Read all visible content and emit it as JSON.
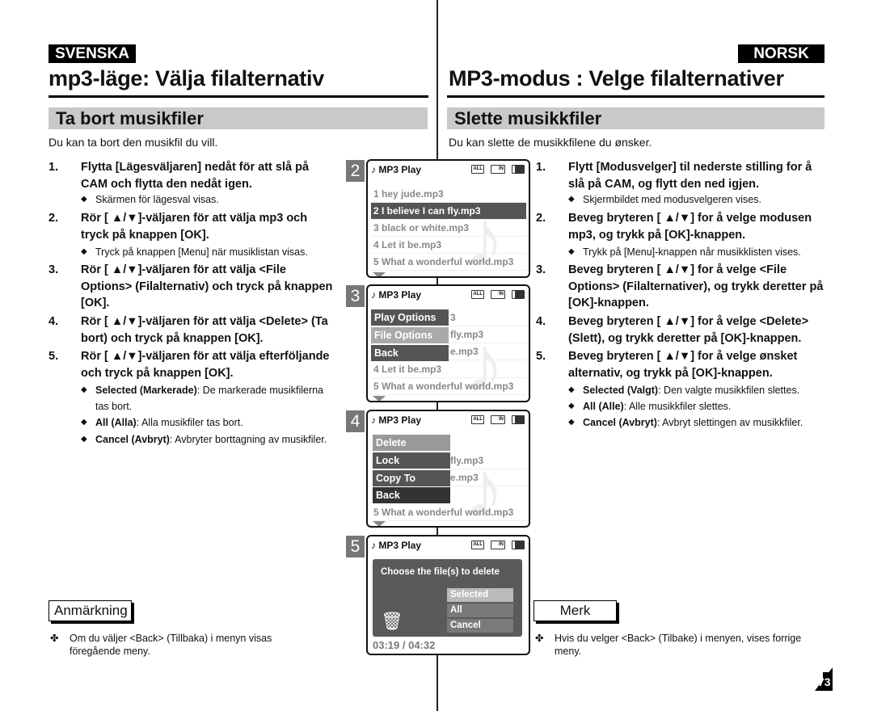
{
  "sv": {
    "lang": "SVENSKA",
    "title": "mp3-läge: Välja filalternativ",
    "section": "Ta bort musikfiler",
    "intro": "Du kan ta bort den musikfil du vill.",
    "steps": [
      {
        "n": "1.",
        "text": "Flytta [Lägesväljaren] nedåt för att slå på CAM och flytta den nedåt igen."
      },
      {
        "n": "2.",
        "text": "Rör [ ▲/▼]-väljaren för att välja mp3 och tryck på knappen [OK]."
      },
      {
        "n": "3.",
        "text": "Rör [ ▲/▼]-väljaren för att välja <File Options> (Filalternativ) och tryck på knappen [OK]."
      },
      {
        "n": "4.",
        "text": "Rör [ ▲/▼]-väljaren för att välja <Delete> (Ta bort) och tryck på knappen [OK]."
      },
      {
        "n": "5.",
        "text": "Rör [ ▲/▼]-väljaren för att välja efterföljande och tryck på knappen [OK]."
      }
    ],
    "bullets": [
      {
        "bold": "",
        "text": "Skärmen för lägesval visas."
      },
      {
        "bold": "",
        "text": "Tryck på knappen [Menu] när musiklistan visas."
      },
      {
        "bold": "Selected (Markerade)",
        "text": ": De markerade musikfilerna tas bort."
      },
      {
        "bold": "All (Alla)",
        "text": ": Alla musikfiler tas bort."
      },
      {
        "bold": "Cancel (Avbryt)",
        "text": ": Avbryter borttagning av musikfiler."
      }
    ],
    "note_label": "Anmärkning",
    "note": "Om du väljer <Back> (Tillbaka) i menyn visas föregående meny."
  },
  "no": {
    "lang": "NORSK",
    "title": "MP3-modus : Velge filalternativer",
    "section": "Slette musikkfiler",
    "intro": "Du kan slette de musikkfilene du ønsker.",
    "steps": [
      {
        "n": "1.",
        "text": "Flytt [Modusvelger] til nederste stilling for å slå på CAM, og flytt den ned igjen."
      },
      {
        "n": "2.",
        "text": "Beveg bryteren [ ▲/▼] for å velge modusen mp3, og trykk på [OK]-knappen."
      },
      {
        "n": "3.",
        "text": "Beveg bryteren [ ▲/▼] for å velge <File Options> (Filalternativer), og trykk deretter på [OK]-knappen."
      },
      {
        "n": "4.",
        "text": "Beveg bryteren [ ▲/▼] for å velge <Delete> (Slett), og trykk deretter på [OK]-knappen."
      },
      {
        "n": "5.",
        "text": "Beveg bryteren [ ▲/▼] for å velge ønsket alternativ, og trykk på [OK]-knappen."
      }
    ],
    "bullets": [
      {
        "bold": "",
        "text": "Skjermbildet med modusvelgeren vises."
      },
      {
        "bold": "",
        "text": "Trykk på [Menu]-knappen når musikklisten vises."
      },
      {
        "bold": "Selected (Valgt)",
        "text": ": Den valgte musikkfilen slettes."
      },
      {
        "bold": "All (Alle)",
        "text": ": Alle musikkfiler slettes."
      },
      {
        "bold": "Cancel (Avbryt)",
        "text": ": Avbryt slettingen av musikkfiler."
      }
    ],
    "note_label": "Merk",
    "note": "Hvis du velger <Back> (Tilbake) i menyen, vises forrige meny."
  },
  "screens": {
    "header": "MP3 Play",
    "icon_all": "ALL",
    "icon_in": "IN",
    "s2": {
      "num": "2",
      "rows": [
        "1  hey jude.mp3",
        "2  I believe I can fly.mp3",
        "3  black or white.mp3",
        "4  Let it be.mp3",
        "5  What a wonderful world.mp3"
      ]
    },
    "s3": {
      "num": "3",
      "menu": [
        "Play Options",
        "File Options",
        "Back"
      ],
      "rows": [
        "3",
        "fly.mp3",
        "e.mp3",
        "4  Let it be.mp3",
        "5  What a wonderful world.mp3"
      ]
    },
    "s4": {
      "num": "4",
      "menu": [
        "Delete",
        "Lock",
        "Copy To",
        "Back"
      ],
      "rows": [
        "fly.mp3",
        "e.mp3",
        "5  What a wonderful world.mp3"
      ]
    },
    "s5": {
      "num": "5",
      "prompt": "Choose the file(s) to delete",
      "options": [
        "Selected",
        "All",
        "Cancel"
      ],
      "time": "03:19 / 04:32"
    }
  },
  "page_number": "73"
}
